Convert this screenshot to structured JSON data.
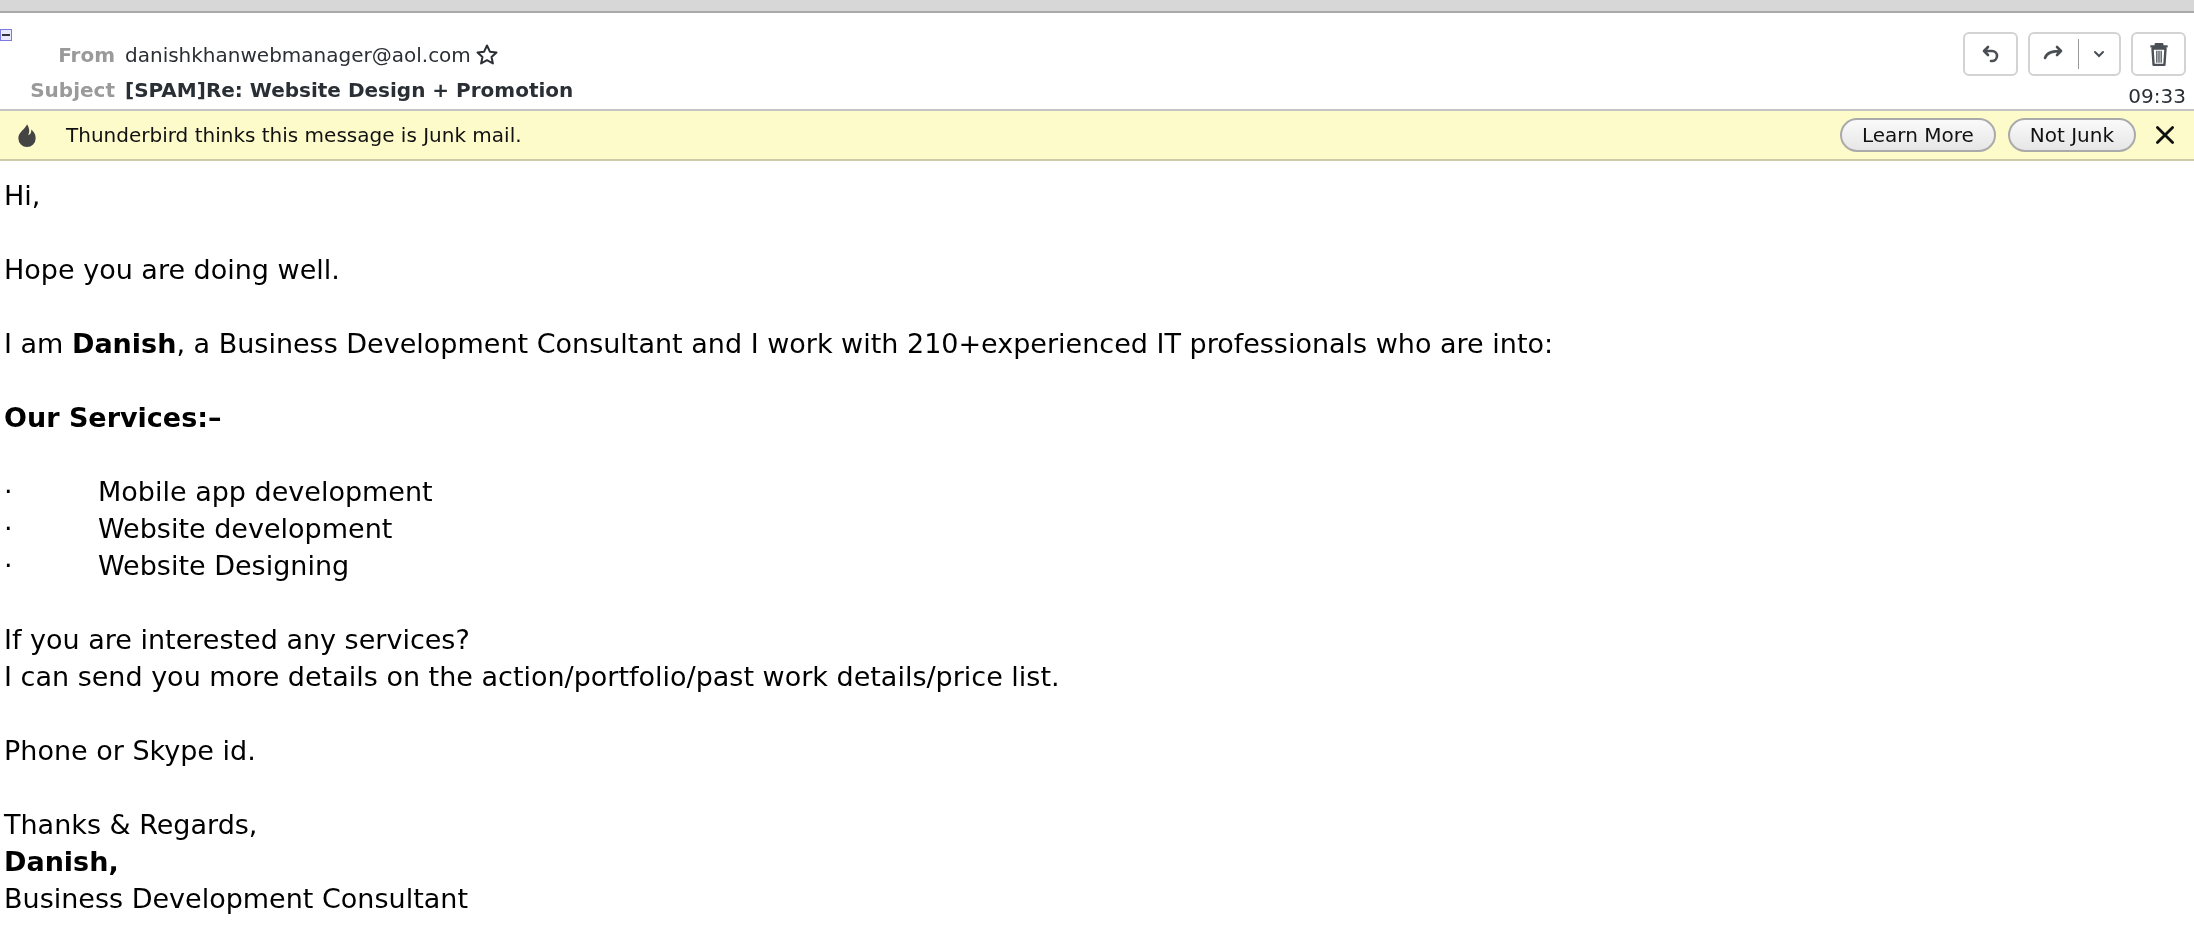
{
  "header": {
    "from": {
      "label": "From",
      "value": "danishkhanwebmanager@aol.com",
      "starred": false
    },
    "subject": {
      "label": "Subject",
      "value": "[SPAM]Re: Website Design + Promotion"
    },
    "time": "09:33"
  },
  "junk_bar": {
    "message": "Thunderbird thinks this message is Junk mail.",
    "buttons": [
      "Learn More",
      "Not Junk"
    ]
  },
  "body": [
    {
      "kind": "text",
      "lines": [
        {
          "text": "Hi,",
          "bold": false
        }
      ]
    },
    {
      "kind": "text",
      "lines": [
        {
          "text": "Hope you are doing well.",
          "bold": false
        }
      ]
    },
    {
      "kind": "text",
      "lines": [
        {
          "text": "I am **Danish**, a Business Development Consultant and I work with 210+experienced IT professionals who are into:",
          "bold": false
        }
      ]
    },
    {
      "kind": "text",
      "lines": [
        {
          "text": "Our Services:–",
          "bold": true
        }
      ]
    },
    {
      "kind": "list",
      "items": [
        {
          "bullet": "·",
          "text": "Mobile app development"
        },
        {
          "bullet": "·",
          "text": "Website development"
        },
        {
          "bullet": "·",
          "text": "Website Designing"
        }
      ]
    },
    {
      "kind": "text",
      "lines": [
        {
          "text": "If you are interested any services?",
          "bold": false
        },
        {
          "text": "I can send you more details on the action/portfolio/past work details/price list.",
          "bold": false
        }
      ]
    },
    {
      "kind": "text",
      "lines": [
        {
          "text": "Phone or Skype id.",
          "bold": false
        }
      ]
    },
    {
      "kind": "text",
      "lines": [
        {
          "text": "Thanks & Regards,",
          "bold": false
        },
        {
          "text": "Danish,",
          "bold": true
        },
        {
          "text": "Business Development Consultant",
          "bold": false
        }
      ]
    }
  ]
}
